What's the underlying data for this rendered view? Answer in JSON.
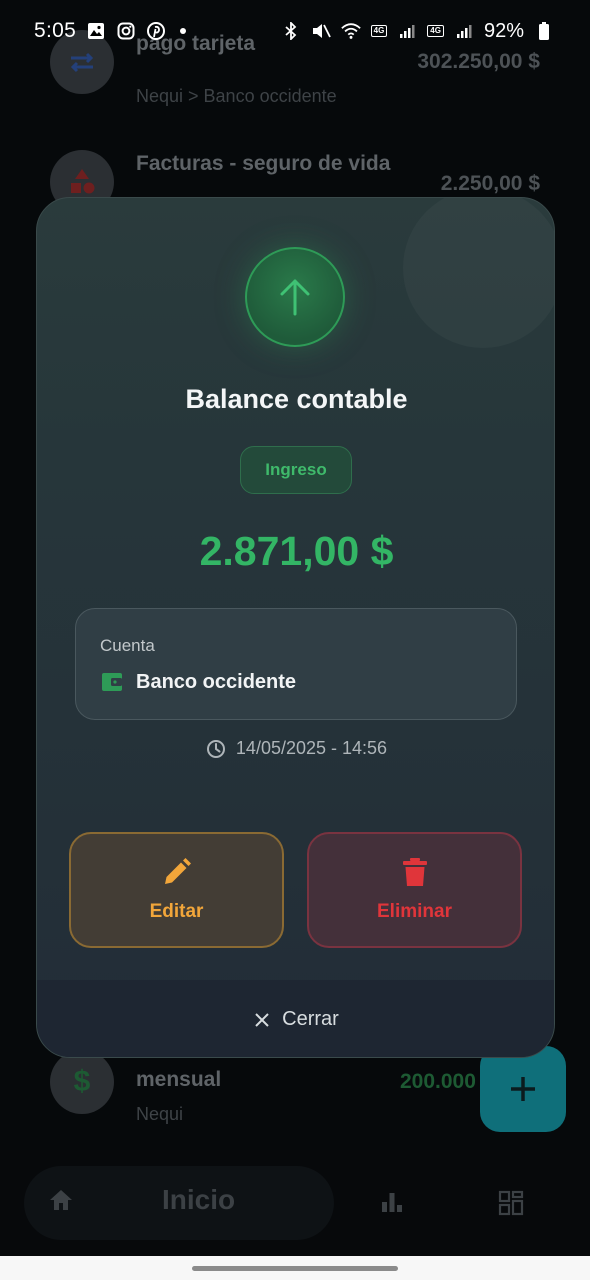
{
  "status_bar": {
    "time": "5:05",
    "battery_percent": "92%",
    "network_badge_1": "4G",
    "network_badge_2": "4G"
  },
  "background_list": {
    "items": [
      {
        "title": "pago tarjeta",
        "subtitle": "Nequi > Banco occidente",
        "amount": "302.250,00 $",
        "icon": "transfer-icon"
      },
      {
        "title": "Facturas - seguro de vida",
        "subtitle": "",
        "amount": "2.250,00 $",
        "icon": "shapes-icon"
      },
      {
        "title": "mensual",
        "subtitle": "Nequi",
        "amount": "200.000",
        "icon": "dollar-icon"
      }
    ]
  },
  "bottom_nav": {
    "home_label": "Inicio"
  },
  "modal": {
    "icon": "arrow-up-icon",
    "title": "Balance contable",
    "type_badge": "Ingreso",
    "amount": "2.871,00 $",
    "account_label": "Cuenta",
    "account_name": "Banco occidente",
    "datetime": "14/05/2025 - 14:56",
    "edit_label": "Editar",
    "delete_label": "Eliminar",
    "close_label": "Cerrar"
  },
  "colors": {
    "income_green": "#33b565",
    "edit_orange": "#f2a63a",
    "delete_red": "#e0353a",
    "fab_teal": "#0f6f7a"
  }
}
